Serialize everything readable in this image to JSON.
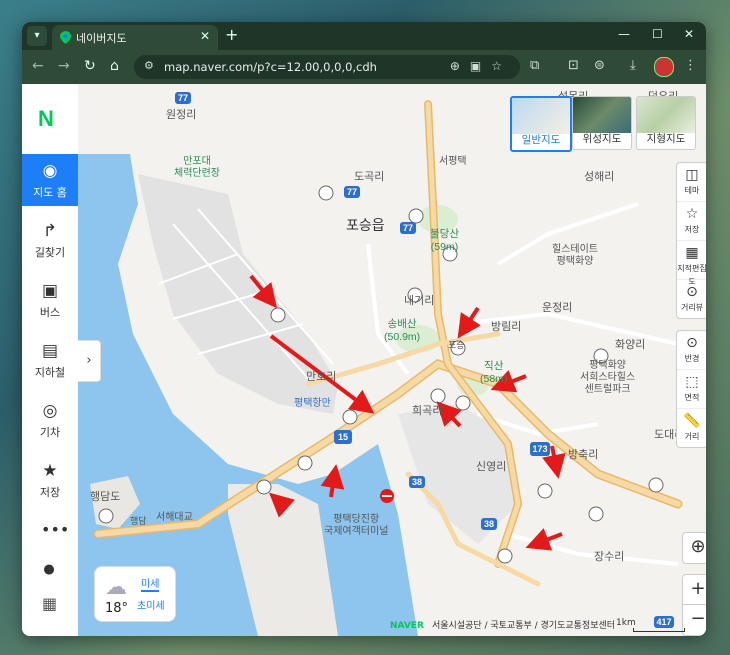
{
  "browser": {
    "tab_title": "네이버지도",
    "url": "map.naver.com/p?c=12.00,0,0,0,cdh",
    "icons": [
      "tab-search-icon",
      "close-icon",
      "plus-icon",
      "minimize-icon",
      "maximize-icon",
      "window-close-icon",
      "back-icon",
      "forward-icon",
      "reload-icon",
      "home-icon",
      "site-info-icon",
      "zoom-icon",
      "cast-icon",
      "star-icon",
      "extensions-icon",
      "screenshot-icon",
      "reader-icon",
      "download-icon",
      "profile-avatar",
      "menu-dots-icon"
    ]
  },
  "sidebar": {
    "logo": "N",
    "items": [
      {
        "label": "지도 홈",
        "icon": "map-pin-icon",
        "active": true
      },
      {
        "label": "길찾기",
        "icon": "directions-icon"
      },
      {
        "label": "버스",
        "icon": "bus-icon"
      },
      {
        "label": "지하철",
        "icon": "subway-icon"
      },
      {
        "label": "기차",
        "icon": "train-icon"
      },
      {
        "label": "저장",
        "icon": "star-icon"
      }
    ],
    "more": "•••"
  },
  "map_types": [
    {
      "label": "일반지도",
      "active": true
    },
    {
      "label": "위성지도"
    },
    {
      "label": "지형지도"
    }
  ],
  "tools": [
    {
      "label": "테마",
      "icon": "layers-icon"
    },
    {
      "label": "저장",
      "icon": "star-icon"
    },
    {
      "label": "지적편집도",
      "icon": "cadastral-icon"
    },
    {
      "label": "거리뷰",
      "icon": "streetview-icon"
    },
    {
      "label": "반경",
      "icon": "radius-icon"
    },
    {
      "label": "면적",
      "icon": "area-icon"
    },
    {
      "label": "거리",
      "icon": "ruler-icon"
    }
  ],
  "zoom": {
    "in": "+",
    "out": "−"
  },
  "weather": {
    "temp": "18°",
    "fine_dust": "미세",
    "ultra_fine_dust": "초미세"
  },
  "footer": {
    "brand": "NAVER",
    "credits": "서울시설공단 / 국토교통부 / 경기도교통정보센터",
    "scale": "1km"
  },
  "places": {
    "wonjeongri": "원정리",
    "manpodae": "만포대\n체력단련장",
    "dogokri": "도곡리",
    "posungeup": "포승읍",
    "seopyeongtaek": "서평택",
    "bulgdangsan": "불당산\n(59m)",
    "seonghaeri": "성해리",
    "hillstate": "힐스테이트\n평택화양",
    "naegiri": "내기리",
    "seolmoongri": "설목리",
    "deokuri": "덕우리",
    "ungjeongri": "운정리",
    "hwayangri": "화양리",
    "bangrimri": "방림리",
    "songbaesan": "송배산\n(50.9m)",
    "posung_ic": "포승",
    "jikboksan": "직산\n(58m)",
    "pyeongtaek_hwayang": "평택화양\n서희스타힐스\n센트럴파크",
    "mannori": "만호리",
    "pyeongtaek_port": "평택항만",
    "huigokri": "희곡리",
    "dodaeri": "도대리",
    "bangchukri": "방축리",
    "sinyeongri": "신영리",
    "haengdamdo": "행담도",
    "haengdam_ic": "행담",
    "seohae_bridge": "서해대교",
    "terminal": "평택당진항\n국제여객터미널",
    "jangsuri": "장수리"
  },
  "routes": [
    "77",
    "77",
    "77",
    "15",
    "173",
    "38",
    "38",
    "417"
  ],
  "palette": {
    "road": "#f6d9a4",
    "road_edge": "#e8b96a",
    "water": "#8ec5ee",
    "land": "#f3f2ef",
    "block": "#e2e2e2",
    "arrow": "#e21a1a",
    "active": "#1d7ef7",
    "naver_green": "#03c75a"
  }
}
